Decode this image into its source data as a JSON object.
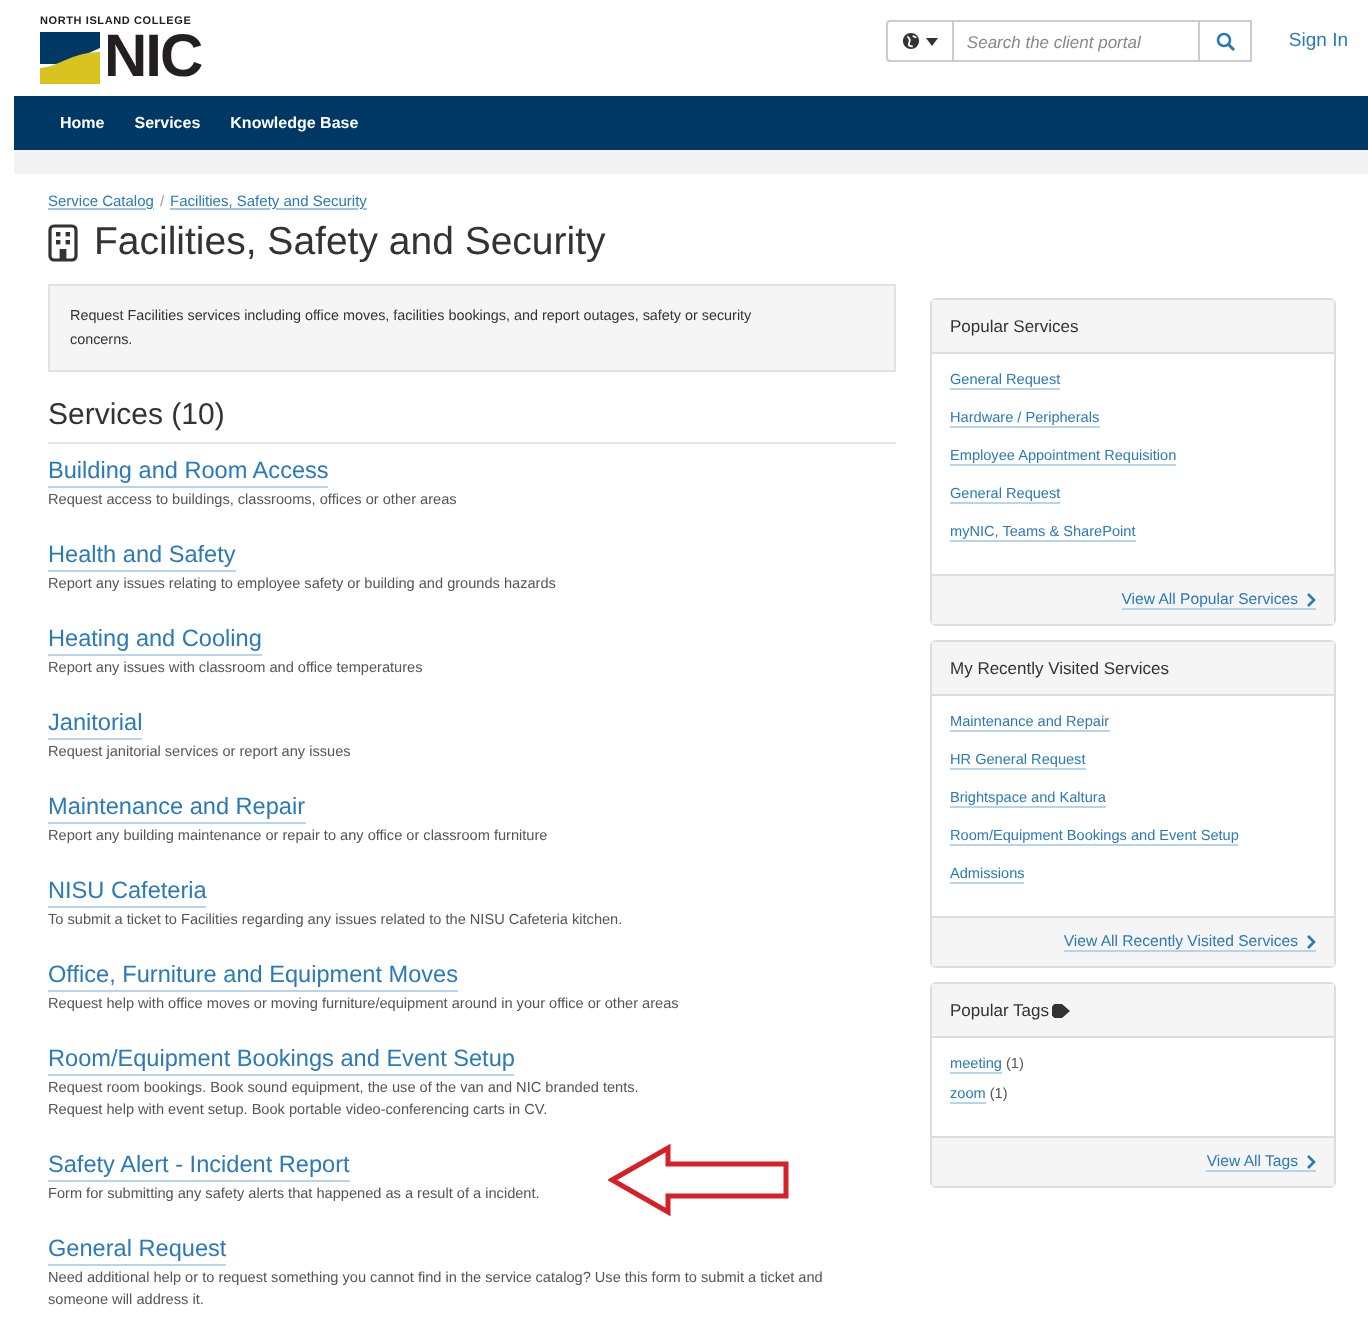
{
  "header": {
    "logo": {
      "tagline": "NORTH ISLAND COLLEGE",
      "wordmark": "NIC"
    },
    "language_button": {
      "expanded": false
    },
    "search": {
      "placeholder": "Search the client portal"
    },
    "sign_in": "Sign In"
  },
  "nav": [
    {
      "label": "Home"
    },
    {
      "label": "Services"
    },
    {
      "label": "Knowledge Base"
    }
  ],
  "breadcrumb": [
    "Service Catalog",
    "Facilities, Safety and Security"
  ],
  "breadcrumb_separator": "/",
  "page_title": "Facilities, Safety and Security",
  "description": "Request Facilities services including office moves, facilities bookings, and report outages, safety or security concerns.",
  "services_heading": "Services (10)",
  "services": [
    {
      "title": "Building and Room Access",
      "description": [
        "Request access to buildings, classrooms, offices or other areas"
      ]
    },
    {
      "title": "Health and Safety",
      "description": [
        "Report any issues relating to employee safety or building and grounds hazards"
      ]
    },
    {
      "title": "Heating and Cooling",
      "description": [
        "Report any issues with classroom and office temperatures"
      ]
    },
    {
      "title": "Janitorial",
      "description": [
        "Request janitorial services or report any issues"
      ]
    },
    {
      "title": "Maintenance and Repair",
      "description": [
        "Report any building maintenance or repair to any office or classroom furniture"
      ]
    },
    {
      "title": "NISU Cafeteria",
      "description": [
        "To submit a ticket to Facilities regarding any issues related to the NISU Cafeteria kitchen."
      ]
    },
    {
      "title": "Office, Furniture and Equipment Moves",
      "description": [
        "Request help with office moves or moving furniture/equipment around in your office or other areas"
      ]
    },
    {
      "title": "Room/Equipment Bookings and Event Setup",
      "description": [
        "Request room bookings. Book sound equipment, the use of the van and NIC branded tents.",
        "Request help with event setup. Book portable video-conferencing carts in CV."
      ]
    },
    {
      "title": "Safety Alert - Incident Report",
      "description": [
        "Form for submitting any safety alerts that happened as a result of a incident."
      ],
      "highlighted": true
    },
    {
      "title": "General Request",
      "description": [
        "Need additional help or to request something you cannot find in the service catalog? Use this form to submit a ticket and",
        "someone will address it."
      ]
    }
  ],
  "sidebar": [
    {
      "kind": "links",
      "title": "Popular Services",
      "items": [
        "General Request",
        "Hardware / Peripherals",
        "Employee Appointment Requisition",
        "General Request",
        "myNIC, Teams & SharePoint"
      ],
      "footer_link": "View All Popular Services"
    },
    {
      "kind": "links",
      "title": "My Recently Visited Services",
      "items": [
        "Maintenance and Repair",
        "HR General Request",
        "Brightspace and Kaltura",
        "Room/Equipment Bookings and Event Setup",
        "Admissions"
      ],
      "footer_link": "View All Recently Visited Services"
    },
    {
      "kind": "tags",
      "title": "Popular Tags",
      "tags": [
        {
          "name": "meeting",
          "count": "(1)"
        },
        {
          "name": "zoom",
          "count": "(1)"
        }
      ],
      "footer_link": "View All Tags"
    }
  ]
}
